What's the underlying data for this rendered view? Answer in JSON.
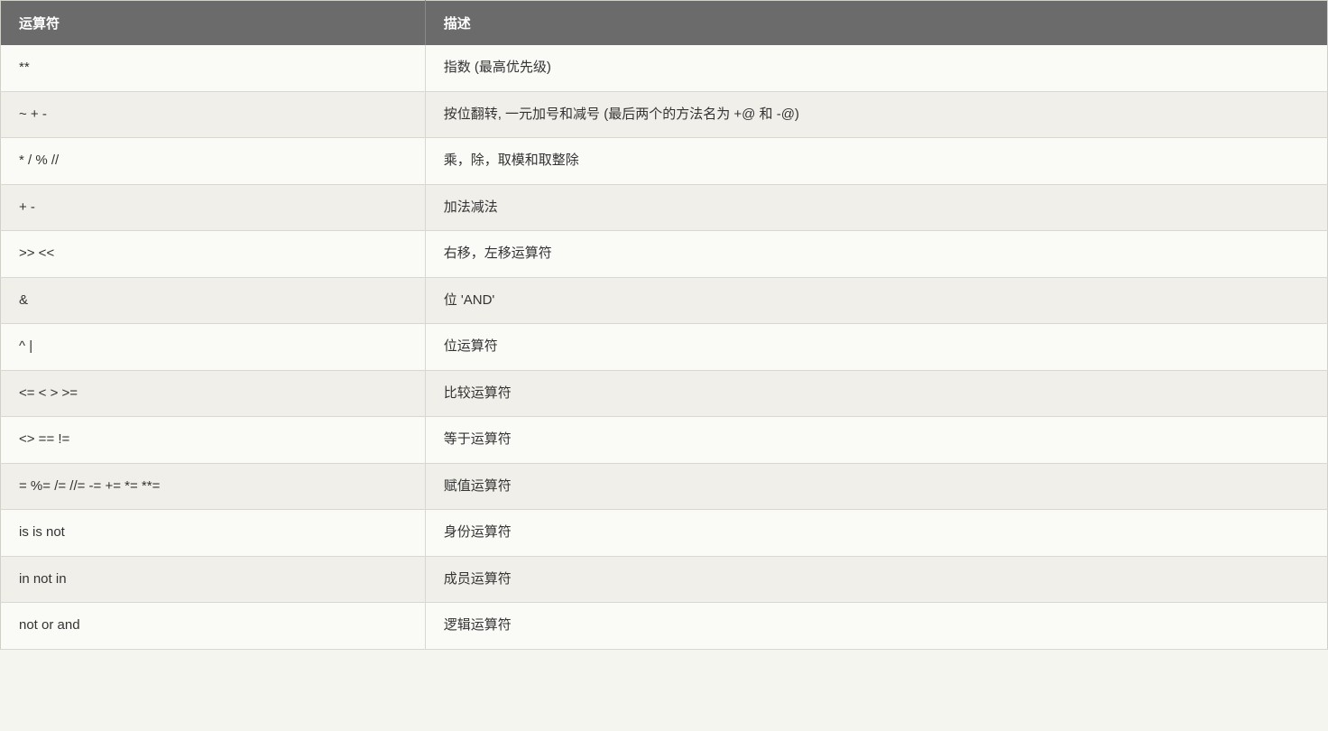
{
  "table": {
    "headers": {
      "operator": "运算符",
      "description": "描述"
    },
    "rows": [
      {
        "operator": "**",
        "description": "指数 (最高优先级)"
      },
      {
        "operator": "~ + -",
        "description": "按位翻转, 一元加号和减号 (最后两个的方法名为 +@ 和 -@)"
      },
      {
        "operator": "* / % //",
        "description": "乘，除，取模和取整除"
      },
      {
        "operator": "+ -",
        "description": "加法减法"
      },
      {
        "operator": ">> <<",
        "description": "右移，左移运算符"
      },
      {
        "operator": "&",
        "description": "位 'AND'"
      },
      {
        "operator": "^ |",
        "description": "位运算符"
      },
      {
        "operator": "<= < > >=",
        "description": "比较运算符"
      },
      {
        "operator": "<> == !=",
        "description": "等于运算符"
      },
      {
        "operator": "= %= /= //= -= += *= **=",
        "description": "赋值运算符"
      },
      {
        "operator": "is is not",
        "description": "身份运算符"
      },
      {
        "operator": "in not in",
        "description": "成员运算符"
      },
      {
        "operator": "not or and",
        "description": "逻辑运算符"
      }
    ]
  }
}
